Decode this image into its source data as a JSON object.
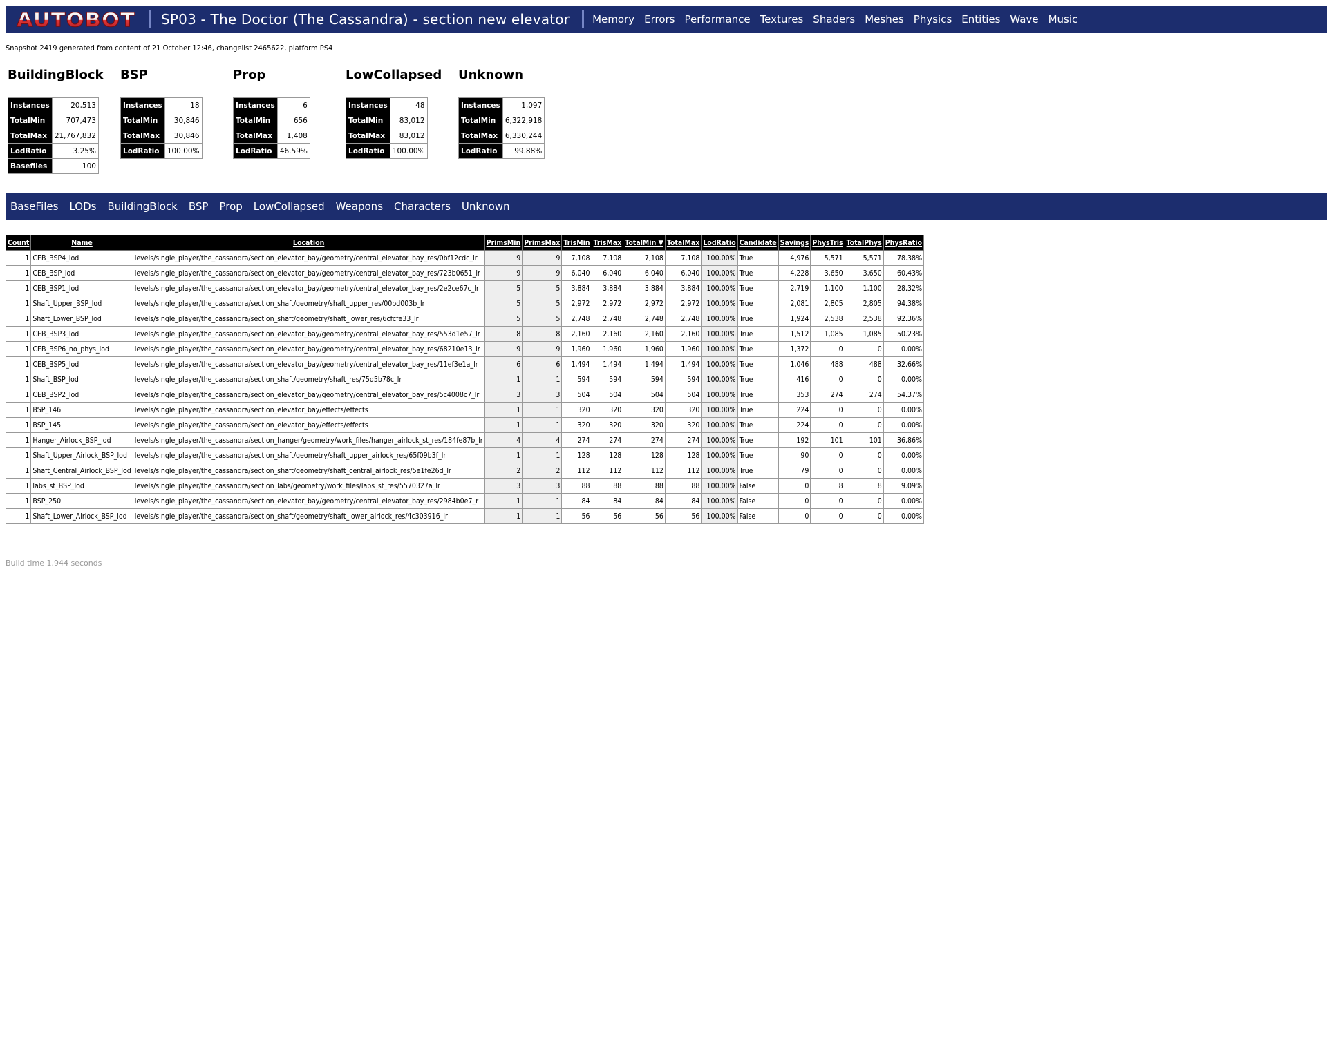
{
  "header": {
    "logo_text": "AUTOBOT",
    "title": "SP03 - The Doctor (The Cassandra) - section new elevator",
    "nav": [
      "Memory",
      "Errors",
      "Performance",
      "Textures",
      "Shaders",
      "Meshes",
      "Physics",
      "Entities",
      "Wave",
      "Music"
    ]
  },
  "snapshot_text": "Snapshot 2419 generated from content of 21 October 12:46, changelist 2465622, platform PS4",
  "summary": [
    {
      "title": "BuildingBlock",
      "rows": [
        [
          "Instances",
          "20,513"
        ],
        [
          "TotalMin",
          "707,473"
        ],
        [
          "TotalMax",
          "21,767,832"
        ],
        [
          "LodRatio",
          "3.25%"
        ],
        [
          "Basefiles",
          "100"
        ]
      ]
    },
    {
      "title": "BSP",
      "rows": [
        [
          "Instances",
          "18"
        ],
        [
          "TotalMin",
          "30,846"
        ],
        [
          "TotalMax",
          "30,846"
        ],
        [
          "LodRatio",
          "100.00%"
        ]
      ]
    },
    {
      "title": "Prop",
      "rows": [
        [
          "Instances",
          "6"
        ],
        [
          "TotalMin",
          "656"
        ],
        [
          "TotalMax",
          "1,408"
        ],
        [
          "LodRatio",
          "46.59%"
        ]
      ]
    },
    {
      "title": "LowCollapsed",
      "rows": [
        [
          "Instances",
          "48"
        ],
        [
          "TotalMin",
          "83,012"
        ],
        [
          "TotalMax",
          "83,012"
        ],
        [
          "LodRatio",
          "100.00%"
        ]
      ]
    },
    {
      "title": "Unknown",
      "rows": [
        [
          "Instances",
          "1,097"
        ],
        [
          "TotalMin",
          "6,322,918"
        ],
        [
          "TotalMax",
          "6,330,244"
        ],
        [
          "LodRatio",
          "99.88%"
        ]
      ]
    }
  ],
  "subnav": [
    "BaseFiles",
    "LODs",
    "BuildingBlock",
    "BSP",
    "Prop",
    "LowCollapsed",
    "Weapons",
    "Characters",
    "Unknown"
  ],
  "table": {
    "columns": [
      "Count",
      "Name",
      "Location",
      "PrimsMin",
      "PrimsMax",
      "TrisMin",
      "TrisMax",
      "TotalMin ▼",
      "TotalMax",
      "LodRatio",
      "Candidate",
      "Savings",
      "PhysTris",
      "TotalPhys",
      "PhysRatio"
    ],
    "rows": [
      [
        "1",
        "CEB_BSP4_lod",
        "levels/single_player/the_cassandra/section_elevator_bay/geometry/central_elevator_bay_res/0bf12cdc_lr",
        "9",
        "9",
        "7,108",
        "7,108",
        "7,108",
        "7,108",
        "100.00%",
        "True",
        "4,976",
        "5,571",
        "5,571",
        "78.38%"
      ],
      [
        "1",
        "CEB_BSP_lod",
        "levels/single_player/the_cassandra/section_elevator_bay/geometry/central_elevator_bay_res/723b0651_lr",
        "9",
        "9",
        "6,040",
        "6,040",
        "6,040",
        "6,040",
        "100.00%",
        "True",
        "4,228",
        "3,650",
        "3,650",
        "60.43%"
      ],
      [
        "1",
        "CEB_BSP1_lod",
        "levels/single_player/the_cassandra/section_elevator_bay/geometry/central_elevator_bay_res/2e2ce67c_lr",
        "5",
        "5",
        "3,884",
        "3,884",
        "3,884",
        "3,884",
        "100.00%",
        "True",
        "2,719",
        "1,100",
        "1,100",
        "28.32%"
      ],
      [
        "1",
        "Shaft_Upper_BSP_lod",
        "levels/single_player/the_cassandra/section_shaft/geometry/shaft_upper_res/00bd003b_lr",
        "5",
        "5",
        "2,972",
        "2,972",
        "2,972",
        "2,972",
        "100.00%",
        "True",
        "2,081",
        "2,805",
        "2,805",
        "94.38%"
      ],
      [
        "1",
        "Shaft_Lower_BSP_lod",
        "levels/single_player/the_cassandra/section_shaft/geometry/shaft_lower_res/6cfcfe33_lr",
        "5",
        "5",
        "2,748",
        "2,748",
        "2,748",
        "2,748",
        "100.00%",
        "True",
        "1,924",
        "2,538",
        "2,538",
        "92.36%"
      ],
      [
        "1",
        "CEB_BSP3_lod",
        "levels/single_player/the_cassandra/section_elevator_bay/geometry/central_elevator_bay_res/553d1e57_lr",
        "8",
        "8",
        "2,160",
        "2,160",
        "2,160",
        "2,160",
        "100.00%",
        "True",
        "1,512",
        "1,085",
        "1,085",
        "50.23%"
      ],
      [
        "1",
        "CEB_BSP6_no_phys_lod",
        "levels/single_player/the_cassandra/section_elevator_bay/geometry/central_elevator_bay_res/68210e13_lr",
        "9",
        "9",
        "1,960",
        "1,960",
        "1,960",
        "1,960",
        "100.00%",
        "True",
        "1,372",
        "0",
        "0",
        "0.00%"
      ],
      [
        "1",
        "CEB_BSP5_lod",
        "levels/single_player/the_cassandra/section_elevator_bay/geometry/central_elevator_bay_res/11ef3e1a_lr",
        "6",
        "6",
        "1,494",
        "1,494",
        "1,494",
        "1,494",
        "100.00%",
        "True",
        "1,046",
        "488",
        "488",
        "32.66%"
      ],
      [
        "1",
        "Shaft_BSP_lod",
        "levels/single_player/the_cassandra/section_shaft/geometry/shaft_res/75d5b78c_lr",
        "1",
        "1",
        "594",
        "594",
        "594",
        "594",
        "100.00%",
        "True",
        "416",
        "0",
        "0",
        "0.00%"
      ],
      [
        "1",
        "CEB_BSP2_lod",
        "levels/single_player/the_cassandra/section_elevator_bay/geometry/central_elevator_bay_res/5c4008c7_lr",
        "3",
        "3",
        "504",
        "504",
        "504",
        "504",
        "100.00%",
        "True",
        "353",
        "274",
        "274",
        "54.37%"
      ],
      [
        "1",
        "BSP_146",
        "levels/single_player/the_cassandra/section_elevator_bay/effects/effects",
        "1",
        "1",
        "320",
        "320",
        "320",
        "320",
        "100.00%",
        "True",
        "224",
        "0",
        "0",
        "0.00%"
      ],
      [
        "1",
        "BSP_145",
        "levels/single_player/the_cassandra/section_elevator_bay/effects/effects",
        "1",
        "1",
        "320",
        "320",
        "320",
        "320",
        "100.00%",
        "True",
        "224",
        "0",
        "0",
        "0.00%"
      ],
      [
        "1",
        "Hanger_Airlock_BSP_lod",
        "levels/single_player/the_cassandra/section_hanger/geometry/work_files/hanger_airlock_st_res/184fe87b_lr",
        "4",
        "4",
        "274",
        "274",
        "274",
        "274",
        "100.00%",
        "True",
        "192",
        "101",
        "101",
        "36.86%"
      ],
      [
        "1",
        "Shaft_Upper_Airlock_BSP_lod",
        "levels/single_player/the_cassandra/section_shaft/geometry/shaft_upper_airlock_res/65f09b3f_lr",
        "1",
        "1",
        "128",
        "128",
        "128",
        "128",
        "100.00%",
        "True",
        "90",
        "0",
        "0",
        "0.00%"
      ],
      [
        "1",
        "Shaft_Central_Airlock_BSP_lod",
        "levels/single_player/the_cassandra/section_shaft/geometry/shaft_central_airlock_res/5e1fe26d_lr",
        "2",
        "2",
        "112",
        "112",
        "112",
        "112",
        "100.00%",
        "True",
        "79",
        "0",
        "0",
        "0.00%"
      ],
      [
        "1",
        "labs_st_BSP_lod",
        "levels/single_player/the_cassandra/section_labs/geometry/work_files/labs_st_res/5570327a_lr",
        "3",
        "3",
        "88",
        "88",
        "88",
        "88",
        "100.00%",
        "False",
        "0",
        "8",
        "8",
        "9.09%"
      ],
      [
        "1",
        "BSP_250",
        "levels/single_player/the_cassandra/section_elevator_bay/geometry/central_elevator_bay_res/2984b0e7_r",
        "1",
        "1",
        "84",
        "84",
        "84",
        "84",
        "100.00%",
        "False",
        "0",
        "0",
        "0",
        "0.00%"
      ],
      [
        "1",
        "Shaft_Lower_Airlock_BSP_lod",
        "levels/single_player/the_cassandra/section_shaft/geometry/shaft_lower_airlock_res/4c303916_lr",
        "1",
        "1",
        "56",
        "56",
        "56",
        "56",
        "100.00%",
        "False",
        "0",
        "0",
        "0",
        "0.00%"
      ]
    ]
  },
  "build_time": "Build time 1.944 seconds",
  "colors": {
    "bar": "#1c2d6e",
    "logo_red": "#c8202a"
  }
}
